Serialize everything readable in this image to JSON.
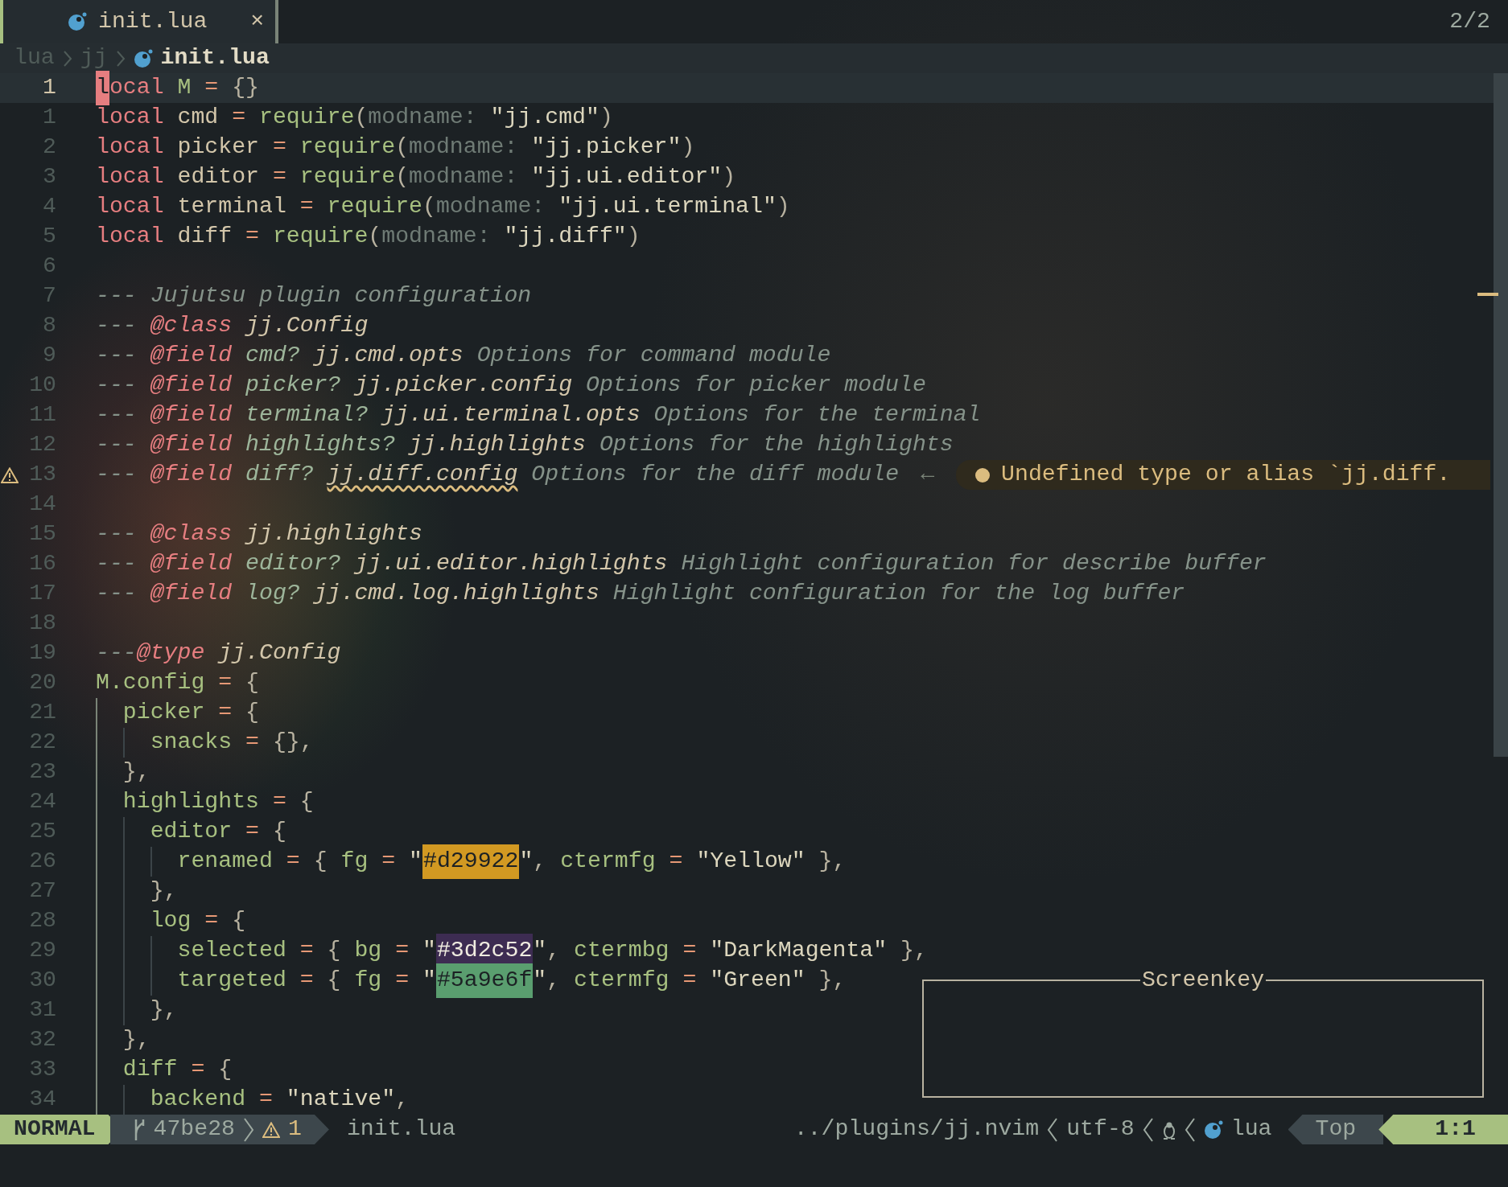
{
  "tabline": {
    "tab": {
      "label": "init.lua",
      "close": "×",
      "selected": true
    },
    "counter": "2/2"
  },
  "breadcrumb": [
    "lua",
    "jj",
    "init.lua"
  ],
  "lines": [
    {
      "number": "1",
      "current": true,
      "tokens": [
        {
          "kind": "cursor",
          "text": "l"
        },
        {
          "kind": "kw",
          "text": "ocal"
        },
        {
          "kind": "key",
          "text": " M"
        },
        {
          "kind": "op",
          "text": " = "
        },
        {
          "kind": "punct",
          "text": "{}"
        }
      ]
    },
    {
      "number": "1",
      "current": false,
      "tokens": [
        {
          "kind": "kw",
          "text": "local"
        },
        {
          "kind": "id",
          "text": " cmd"
        },
        {
          "kind": "op",
          "text": " = "
        },
        {
          "kind": "fn",
          "text": "require"
        },
        {
          "kind": "punct",
          "text": "("
        },
        {
          "kind": "hint",
          "text": "modname:"
        },
        {
          "kind": "str",
          "text": " \"jj.cmd\""
        },
        {
          "kind": "punct",
          "text": ")"
        }
      ]
    },
    {
      "number": "2",
      "current": false,
      "tokens": [
        {
          "kind": "kw",
          "text": "local"
        },
        {
          "kind": "id",
          "text": " picker"
        },
        {
          "kind": "op",
          "text": " = "
        },
        {
          "kind": "fn",
          "text": "require"
        },
        {
          "kind": "punct",
          "text": "("
        },
        {
          "kind": "hint",
          "text": "modname:"
        },
        {
          "kind": "str",
          "text": " \"jj.picker\""
        },
        {
          "kind": "punct",
          "text": ")"
        }
      ]
    },
    {
      "number": "3",
      "current": false,
      "tokens": [
        {
          "kind": "kw",
          "text": "local"
        },
        {
          "kind": "id",
          "text": " editor"
        },
        {
          "kind": "op",
          "text": " = "
        },
        {
          "kind": "fn",
          "text": "require"
        },
        {
          "kind": "punct",
          "text": "("
        },
        {
          "kind": "hint",
          "text": "modname:"
        },
        {
          "kind": "str",
          "text": " \"jj.ui.editor\""
        },
        {
          "kind": "punct",
          "text": ")"
        }
      ]
    },
    {
      "number": "4",
      "current": false,
      "tokens": [
        {
          "kind": "kw",
          "text": "local"
        },
        {
          "kind": "id",
          "text": " terminal"
        },
        {
          "kind": "op",
          "text": " = "
        },
        {
          "kind": "fn",
          "text": "require"
        },
        {
          "kind": "punct",
          "text": "("
        },
        {
          "kind": "hint",
          "text": "modname:"
        },
        {
          "kind": "str",
          "text": " \"jj.ui.terminal\""
        },
        {
          "kind": "punct",
          "text": ")"
        }
      ]
    },
    {
      "number": "5",
      "current": false,
      "tokens": [
        {
          "kind": "kw",
          "text": "local"
        },
        {
          "kind": "id",
          "text": " diff"
        },
        {
          "kind": "op",
          "text": " = "
        },
        {
          "kind": "fn",
          "text": "require"
        },
        {
          "kind": "punct",
          "text": "("
        },
        {
          "kind": "hint",
          "text": "modname:"
        },
        {
          "kind": "str",
          "text": " \"jj.diff\""
        },
        {
          "kind": "punct",
          "text": ")"
        }
      ]
    },
    {
      "number": "6",
      "current": false
    },
    {
      "number": "7",
      "current": false,
      "tokens": [
        {
          "kind": "cm",
          "text": "--- Jujutsu plugin configuration"
        }
      ]
    },
    {
      "number": "8",
      "current": false,
      "tokens": [
        {
          "kind": "cm",
          "text": "--- "
        },
        {
          "kind": "tag",
          "text": "@class"
        },
        {
          "kind": "type",
          "text": " jj.Config"
        }
      ]
    },
    {
      "number": "9",
      "current": false,
      "tokens": [
        {
          "kind": "cm",
          "text": "--- "
        },
        {
          "kind": "tag",
          "text": "@field"
        },
        {
          "kind": "fld",
          "text": " cmd?"
        },
        {
          "kind": "type",
          "text": " jj.cmd.opts"
        },
        {
          "kind": "cm",
          "text": " Options for command module"
        }
      ]
    },
    {
      "number": "10",
      "current": false,
      "tokens": [
        {
          "kind": "cm",
          "text": "--- "
        },
        {
          "kind": "tag",
          "text": "@field"
        },
        {
          "kind": "fld",
          "text": " picker?"
        },
        {
          "kind": "type",
          "text": " jj.picker.config"
        },
        {
          "kind": "cm",
          "text": " Options for picker module"
        }
      ]
    },
    {
      "number": "11",
      "current": false,
      "tokens": [
        {
          "kind": "cm",
          "text": "--- "
        },
        {
          "kind": "tag",
          "text": "@field"
        },
        {
          "kind": "fld",
          "text": " terminal?"
        },
        {
          "kind": "type",
          "text": " jj.ui.terminal.opts"
        },
        {
          "kind": "cm",
          "text": " Options for the terminal"
        }
      ]
    },
    {
      "number": "12",
      "current": false,
      "tokens": [
        {
          "kind": "cm",
          "text": "--- "
        },
        {
          "kind": "tag",
          "text": "@field"
        },
        {
          "kind": "fld",
          "text": " highlights?"
        },
        {
          "kind": "type",
          "text": " jj.highlights"
        },
        {
          "kind": "cm",
          "text": " Options for the highlights"
        }
      ]
    },
    {
      "number": "13",
      "current": false,
      "sign": {
        "kind": "warning"
      },
      "tokens": [
        {
          "kind": "cm",
          "text": "--- "
        },
        {
          "kind": "tag",
          "text": "@field"
        },
        {
          "kind": "fld",
          "text": " diff? "
        },
        {
          "kind": "badtype",
          "text": "jj.diff.config"
        },
        {
          "kind": "cm",
          "text": " Options for the diff module"
        }
      ],
      "diagnostic": {
        "arrow": "←",
        "message": "Undefined type or alias `jj.diff."
      }
    },
    {
      "number": "14",
      "current": false
    },
    {
      "number": "15",
      "current": false,
      "tokens": [
        {
          "kind": "cm",
          "text": "--- "
        },
        {
          "kind": "tag",
          "text": "@class"
        },
        {
          "kind": "type",
          "text": " jj.highlights"
        }
      ]
    },
    {
      "number": "16",
      "current": false,
      "tokens": [
        {
          "kind": "cm",
          "text": "--- "
        },
        {
          "kind": "tag",
          "text": "@field"
        },
        {
          "kind": "fld",
          "text": " editor?"
        },
        {
          "kind": "type",
          "text": " jj.ui.editor.highlights"
        },
        {
          "kind": "cm",
          "text": " Highlight configuration for describe buffer"
        }
      ]
    },
    {
      "number": "17",
      "current": false,
      "tokens": [
        {
          "kind": "cm",
          "text": "--- "
        },
        {
          "kind": "tag",
          "text": "@field"
        },
        {
          "kind": "fld",
          "text": " log?"
        },
        {
          "kind": "type",
          "text": " jj.cmd.log.highlights"
        },
        {
          "kind": "cm",
          "text": " Highlight configuration for the log buffer"
        }
      ]
    },
    {
      "number": "18",
      "current": false
    },
    {
      "number": "19",
      "current": false,
      "tokens": [
        {
          "kind": "cm",
          "text": "---"
        },
        {
          "kind": "tag",
          "text": "@type"
        },
        {
          "kind": "type",
          "text": " jj.Config"
        }
      ]
    },
    {
      "number": "20",
      "current": false,
      "tokens": [
        {
          "kind": "key",
          "text": "M.config"
        },
        {
          "kind": "op",
          "text": " = "
        },
        {
          "kind": "punct",
          "text": "{"
        }
      ]
    },
    {
      "number": "21",
      "current": false,
      "guides": [
        {
          "active": true
        }
      ],
      "tokens": [
        {
          "kind": "key",
          "text": "picker"
        },
        {
          "kind": "op",
          "text": " = "
        },
        {
          "kind": "punct",
          "text": "{"
        }
      ]
    },
    {
      "number": "22",
      "current": false,
      "guides": [
        {
          "active": true
        },
        {
          "active": false
        }
      ],
      "tokens": [
        {
          "kind": "key",
          "text": "snacks"
        },
        {
          "kind": "op",
          "text": " = "
        },
        {
          "kind": "punct",
          "text": "{},"
        }
      ]
    },
    {
      "number": "23",
      "current": false,
      "guides": [
        {
          "active": true
        }
      ],
      "tokens": [
        {
          "kind": "punct",
          "text": "},"
        }
      ]
    },
    {
      "number": "24",
      "current": false,
      "guides": [
        {
          "active": true
        }
      ],
      "tokens": [
        {
          "kind": "key",
          "text": "highlights"
        },
        {
          "kind": "op",
          "text": " = "
        },
        {
          "kind": "punct",
          "text": "{"
        }
      ]
    },
    {
      "number": "25",
      "current": false,
      "guides": [
        {
          "active": true
        },
        {
          "active": false
        }
      ],
      "tokens": [
        {
          "kind": "key",
          "text": "editor"
        },
        {
          "kind": "op",
          "text": " = "
        },
        {
          "kind": "punct",
          "text": "{"
        }
      ]
    },
    {
      "number": "26",
      "current": false,
      "guides": [
        {
          "active": true
        },
        {
          "active": false
        },
        {
          "active": false
        }
      ],
      "tokens": [
        {
          "kind": "key",
          "text": "renamed"
        },
        {
          "kind": "op",
          "text": " = "
        },
        {
          "kind": "punct",
          "text": "{ "
        },
        {
          "kind": "key",
          "text": "fg"
        },
        {
          "kind": "op",
          "text": " = "
        },
        {
          "kind": "str",
          "text": "\""
        },
        {
          "kind": "swatch",
          "text": "#d29922",
          "color": "#d29922"
        },
        {
          "kind": "str",
          "text": "\""
        },
        {
          "kind": "punct",
          "text": ", "
        },
        {
          "kind": "key",
          "text": "ctermfg"
        },
        {
          "kind": "op",
          "text": " = "
        },
        {
          "kind": "str",
          "text": "\"Yellow\""
        },
        {
          "kind": "punct",
          "text": " },"
        }
      ]
    },
    {
      "number": "27",
      "current": false,
      "guides": [
        {
          "active": true
        },
        {
          "active": false
        }
      ],
      "tokens": [
        {
          "kind": "punct",
          "text": "},"
        }
      ]
    },
    {
      "number": "28",
      "current": false,
      "guides": [
        {
          "active": true
        },
        {
          "active": false
        }
      ],
      "tokens": [
        {
          "kind": "key",
          "text": "log"
        },
        {
          "kind": "op",
          "text": " = "
        },
        {
          "kind": "punct",
          "text": "{"
        }
      ]
    },
    {
      "number": "29",
      "current": false,
      "guides": [
        {
          "active": true
        },
        {
          "active": false
        },
        {
          "active": false
        }
      ],
      "tokens": [
        {
          "kind": "key",
          "text": "selected"
        },
        {
          "kind": "op",
          "text": " = "
        },
        {
          "kind": "punct",
          "text": "{ "
        },
        {
          "kind": "key",
          "text": "bg"
        },
        {
          "kind": "op",
          "text": " = "
        },
        {
          "kind": "str",
          "text": "\""
        },
        {
          "kind": "swatch",
          "text": "#3d2c52",
          "color": "#3d2c52"
        },
        {
          "kind": "str",
          "text": "\""
        },
        {
          "kind": "punct",
          "text": ", "
        },
        {
          "kind": "key",
          "text": "ctermbg"
        },
        {
          "kind": "op",
          "text": " = "
        },
        {
          "kind": "str",
          "text": "\"DarkMagenta\""
        },
        {
          "kind": "punct",
          "text": " },"
        }
      ]
    },
    {
      "number": "30",
      "current": false,
      "guides": [
        {
          "active": true
        },
        {
          "active": false
        },
        {
          "active": false
        }
      ],
      "tokens": [
        {
          "kind": "key",
          "text": "targeted"
        },
        {
          "kind": "op",
          "text": " = "
        },
        {
          "kind": "punct",
          "text": "{ "
        },
        {
          "kind": "key",
          "text": "fg"
        },
        {
          "kind": "op",
          "text": " = "
        },
        {
          "kind": "str",
          "text": "\""
        },
        {
          "kind": "swatch",
          "text": "#5a9e6f",
          "color": "#5a9e6f"
        },
        {
          "kind": "str",
          "text": "\""
        },
        {
          "kind": "punct",
          "text": ", "
        },
        {
          "kind": "key",
          "text": "ctermfg"
        },
        {
          "kind": "op",
          "text": " = "
        },
        {
          "kind": "str",
          "text": "\"Green\""
        },
        {
          "kind": "punct",
          "text": " },"
        }
      ]
    },
    {
      "number": "31",
      "current": false,
      "guides": [
        {
          "active": true
        },
        {
          "active": false
        }
      ],
      "tokens": [
        {
          "kind": "punct",
          "text": "},"
        }
      ]
    },
    {
      "number": "32",
      "current": false,
      "guides": [
        {
          "active": true
        }
      ],
      "tokens": [
        {
          "kind": "punct",
          "text": "},"
        }
      ]
    },
    {
      "number": "33",
      "current": false,
      "guides": [
        {
          "active": true
        }
      ],
      "tokens": [
        {
          "kind": "key",
          "text": "diff"
        },
        {
          "kind": "op",
          "text": " = "
        },
        {
          "kind": "punct",
          "text": "{"
        }
      ]
    },
    {
      "number": "34",
      "current": false,
      "guides": [
        {
          "active": true
        },
        {
          "active": false
        }
      ],
      "tokens": [
        {
          "kind": "key",
          "text": "backend"
        },
        {
          "kind": "op",
          "text": " = "
        },
        {
          "kind": "str",
          "text": "\"native\""
        },
        {
          "kind": "punct",
          "text": ","
        }
      ]
    }
  ],
  "screenkey": {
    "title": "Screenkey"
  },
  "statusline": {
    "mode": "NORMAL",
    "branch": "47be28",
    "warnings": "1",
    "filename": "init.lua",
    "path": "../plugins/jj.nvim",
    "encoding": "utf-8",
    "filetype": "lua",
    "progress": "Top",
    "location": "1:1"
  }
}
